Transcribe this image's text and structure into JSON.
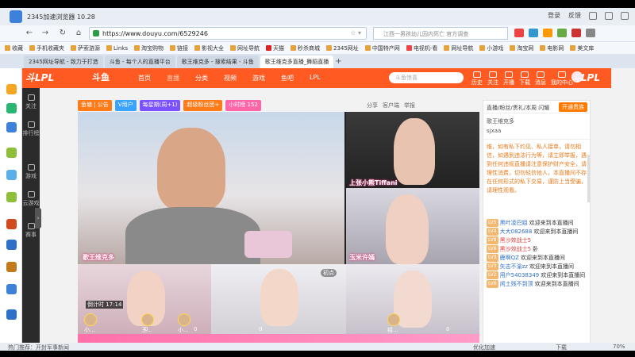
{
  "browser": {
    "title": "2345加速浏览器 10.28",
    "controls": [
      "登录",
      "反馈"
    ],
    "url": "https://www.douyu.com/6529246",
    "search_placeholder": "江西一男孩幼儿园内死亡 官方调查",
    "bookmarks": [
      "收藏",
      "手机收藏夹",
      "萨索游源",
      "Links",
      "淘宝购物",
      "链接",
      "影视大全",
      "网址导航",
      "天猫",
      "秒杀商城",
      "2345网址",
      "中国特产网",
      "电视机-看",
      "网址导航",
      "小游戏",
      "淘宝网",
      "电影网",
      "美文库"
    ],
    "tabs": [
      {
        "label": "2345网址导航 - 致力于打造",
        "active": false
      },
      {
        "label": "斗鱼 - 每个人的直播平台",
        "active": false
      },
      {
        "label": "歌王维克多 - 搜索结果 - 斗鱼",
        "active": false
      },
      {
        "label": "歌王维克多直播_舞蹈直播",
        "active": true
      }
    ]
  },
  "douyu": {
    "logo": "斗LPL",
    "logo_right": "斗LPL",
    "badge": "斗鱼",
    "menu": [
      "首页",
      "直播",
      "分类",
      "视频",
      "游戏",
      "鱼吧",
      "LPL"
    ],
    "search_placeholder": "斗鱼惊喜",
    "top_icons": [
      "历史",
      "关注",
      "开播",
      "下载",
      "消息",
      "我的中心"
    ],
    "side_nav": [
      "关注",
      "排行榜",
      "游戏",
      "云游戏",
      "赛事"
    ]
  },
  "room": {
    "tags": [
      {
        "text": "鱼塘 | 公告",
        "color": "#ff7b1a"
      },
      {
        "text": "V用户",
        "color": "#3aa2ff"
      },
      {
        "text": "每星期(周+1)",
        "color": "#7b52ff"
      },
      {
        "text": "超级粉丝团+",
        "color": "#ff7b1a"
      },
      {
        "text": "小时榜 152",
        "color": "#ff66a8"
      }
    ],
    "right_actions": [
      "分享",
      "客户端",
      "举报"
    ],
    "chat_header": "直播/粉丝/贵礼/本周 闪耀",
    "open_button": "开通贵族",
    "anchor_title": "歌王维克多",
    "anchor_sub": "sjxaa",
    "notice": "维，如有私下约见、私人接单，请勿相信，如遇到违法行为等，请立即举报，遇到任何违规直播请注意保护财产安全，请理性消费，切勿轻信他人，本直播间不存在任何形式的私下交易，谨防上当受骗，请理性观看。",
    "messages": [
      {
        "lv": "LV5",
        "user": "黑叶凌巴姐",
        "text": "欢迎来到本直播间"
      },
      {
        "lv": "LV4",
        "user": "大大082688",
        "text": "欢迎来到本直播间"
      },
      {
        "lv": "LV8",
        "user": "黑沙效战士5",
        "text": ""
      },
      {
        "lv": "LV6",
        "user": "黑沙效战士5",
        "text": "卧"
      },
      {
        "lv": "LV3",
        "user": "鹿啊QZ",
        "text": "欢迎来到本直播间"
      },
      {
        "lv": "LV3",
        "user": "矢志不渝zz",
        "text": "欢迎来到本直播间"
      },
      {
        "lv": "LV2",
        "user": "用户54038349",
        "text": "欢迎来到本直播间"
      },
      {
        "lv": "LV6",
        "user": "闲土残不到顶",
        "text": "欢迎来到本直播间"
      }
    ]
  },
  "video": {
    "captions": [
      "歌王维克多",
      "上张小熊Tiffani",
      "玉米许嫣"
    ],
    "timer": "倒计时 17:14",
    "seats": [
      "小...",
      "王...",
      "小...",
      "组..."
    ],
    "scores": [
      "0",
      "0",
      "0",
      "0"
    ],
    "label": "初点"
  },
  "status": {
    "left": "热门推荐：开封军事新闻",
    "mid": "优化加速",
    "right": "下载",
    "zoom": "70%"
  }
}
